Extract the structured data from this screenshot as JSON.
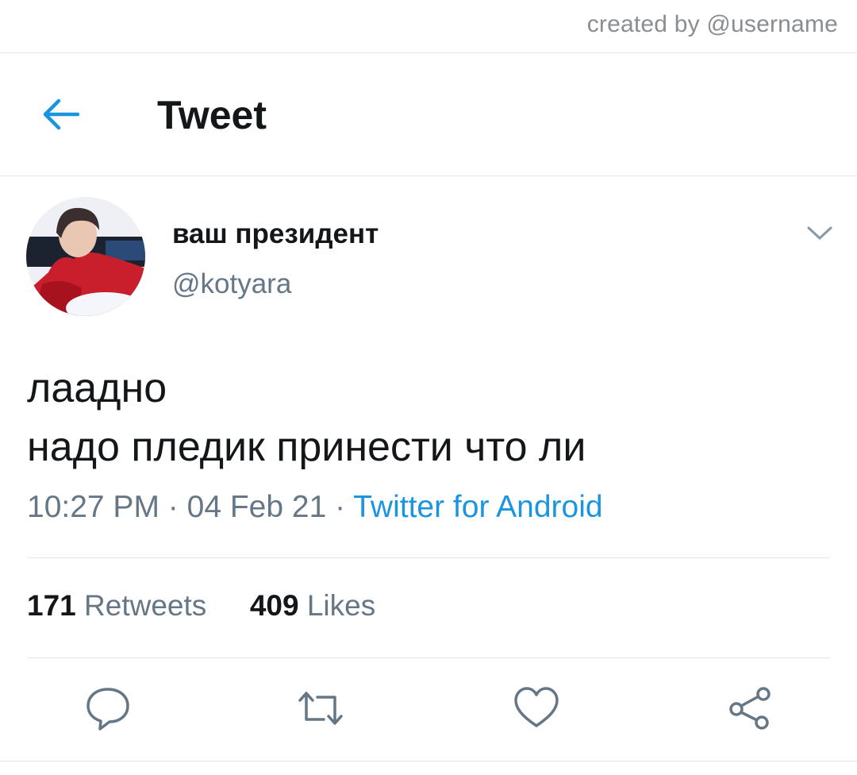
{
  "credit": "created by @username",
  "header": {
    "title": "Tweet",
    "back_icon": "arrow-left-icon"
  },
  "tweet": {
    "display_name": "ваш президент",
    "handle": "@kotyara",
    "text_lines": [
      "лаадно",
      "надо пледик принести что ли"
    ],
    "time": "10:27 PM",
    "date": "04 Feb 21",
    "separator": "·",
    "source": "Twitter for Android"
  },
  "stats": {
    "retweets_count": "171",
    "retweets_label": "Retweets",
    "likes_count": "409",
    "likes_label": "Likes"
  },
  "actions": [
    {
      "name": "reply",
      "icon": "reply-icon"
    },
    {
      "name": "retweet",
      "icon": "retweet-icon"
    },
    {
      "name": "like",
      "icon": "heart-icon"
    },
    {
      "name": "share",
      "icon": "share-icon"
    }
  ],
  "colors": {
    "accent": "#1b95e0",
    "text": "#14171a",
    "secondary": "#657786",
    "divider": "#e1e8ed"
  }
}
